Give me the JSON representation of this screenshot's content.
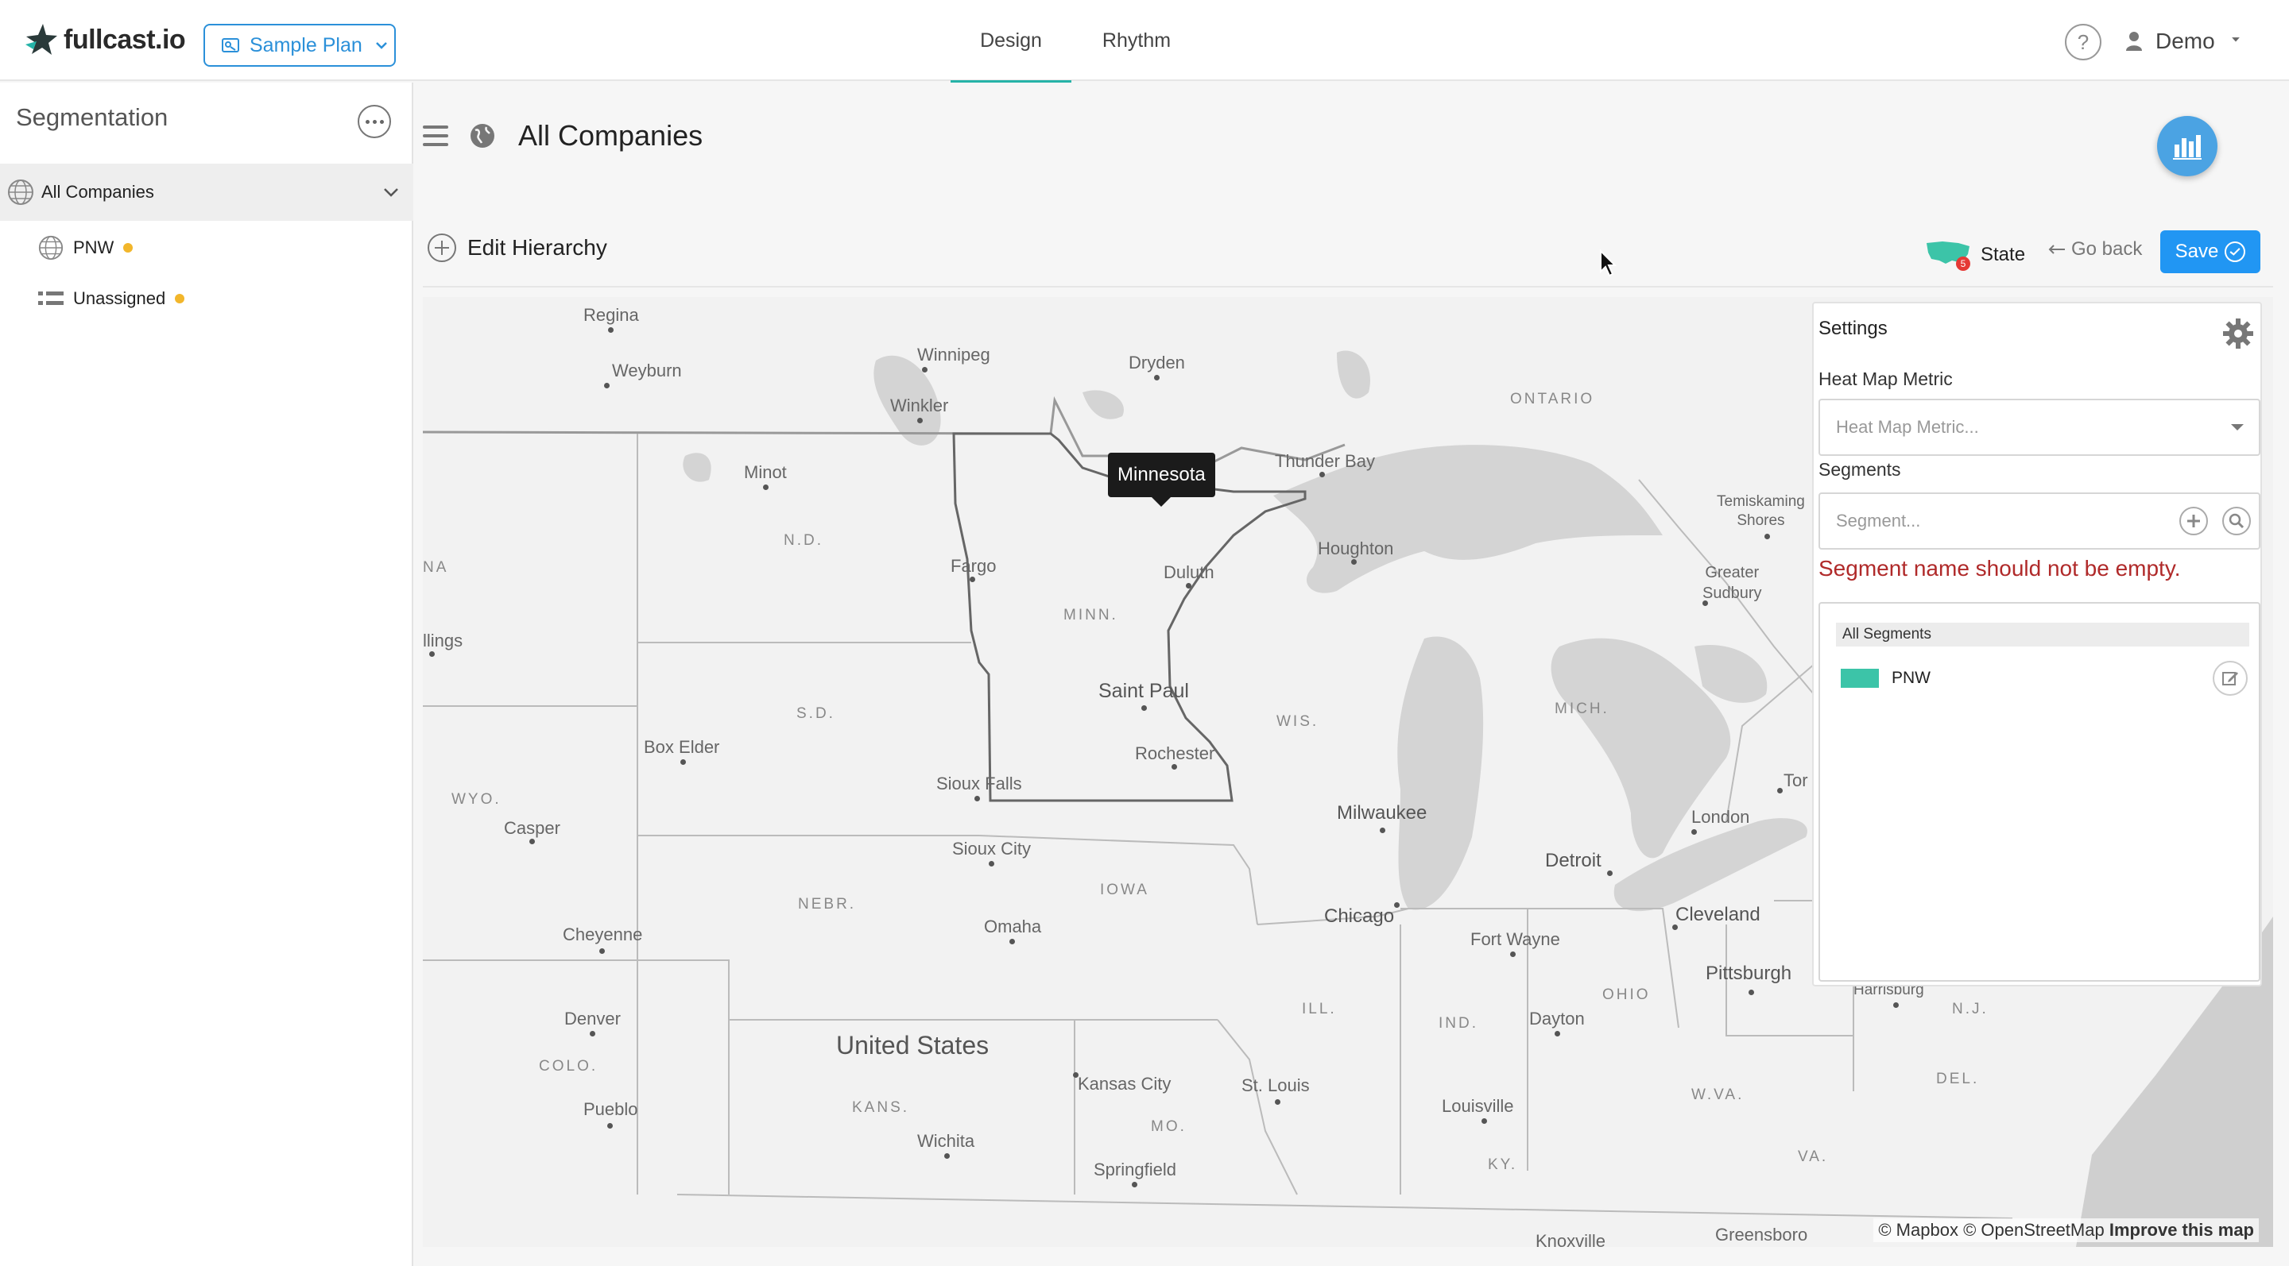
{
  "app": {
    "logo_text": "fullcast.io",
    "plan_button": "Sample Plan",
    "nav_tabs": [
      {
        "label": "Design",
        "active": true
      },
      {
        "label": "Rhythm",
        "active": false
      }
    ],
    "help_label": "?",
    "user_name": "Demo"
  },
  "sidebar": {
    "title": "Segmentation",
    "root_item": "All Companies",
    "children": [
      {
        "label": "PNW",
        "status_color": "#f2b62b"
      },
      {
        "label": "Unassigned",
        "status_color": "#f2b62b"
      }
    ]
  },
  "main": {
    "title": "All Companies",
    "edit_hierarchy": "Edit Hierarchy",
    "state_toggle": "State",
    "state_badge": "5",
    "go_back": "Go back",
    "save": "Save"
  },
  "map": {
    "tooltip": "Minnesota",
    "labels": {
      "regina": "Regina",
      "weyburn": "Weyburn",
      "winnipeg": "Winnipeg",
      "winkler": "Winkler",
      "dryden": "Dryden",
      "ontario": "ONTARIO",
      "thunder_bay": "Thunder Bay",
      "minot": "Minot",
      "nd": "N.D.",
      "fargo": "Fargo",
      "duluth": "Duluth",
      "houghton": "Houghton",
      "minn": "MINN.",
      "temiskaming": "Temiskaming\nShores",
      "greater_sudbury": "Greater\nSudbury",
      "na": "NA",
      "billings": "llings",
      "sd": "S.D.",
      "saint_paul": "Saint Paul",
      "wis": "WIS.",
      "mich": "MICH.",
      "box_elder": "Box Elder",
      "rochester": "Rochester",
      "wyo": "WYO.",
      "casper": "Casper",
      "sioux_falls": "Sioux Falls",
      "milwaukee": "Milwaukee",
      "london": "London",
      "tor": "Tor",
      "sioux_city": "Sioux City",
      "detroit": "Detroit",
      "iowa": "IOWA",
      "nebr": "NEBR.",
      "cleveland": "Cleveland",
      "chicago": "Chicago",
      "omaha": "Omaha",
      "fort_wayne": "Fort Wayne",
      "cheyenne": "Cheyenne",
      "pittsburgh": "Pittsburgh",
      "harrisburg": "Harrisburg",
      "ohio": "OHIO",
      "ill": "ILL.",
      "ind": "IND.",
      "dayton": "Dayton",
      "nj": "N.J.",
      "denver": "Denver",
      "colo": "COLO.",
      "united_states": "United States",
      "kansas_city": "Kansas City",
      "st_louis": "St. Louis",
      "del": "DEL.",
      "wva": "W.VA.",
      "pueblo": "Pueblo",
      "kans": "KANS.",
      "louisville": "Louisville",
      "mo": "MO.",
      "wichita": "Wichita",
      "va": "VA.",
      "ky": "KY.",
      "springfield": "Springfield",
      "knoxville": "Knoxville",
      "greensboro": "Greensboro"
    },
    "attribution": {
      "mapbox": "© Mapbox",
      "osm": "© OpenStreetMap",
      "improve": "Improve this map"
    }
  },
  "settings": {
    "title": "Settings",
    "heatmap_label": "Heat Map Metric",
    "heatmap_placeholder": "Heat Map Metric...",
    "segments_label": "Segments",
    "segment_placeholder": "Segment...",
    "error": "Segment name should not be empty.",
    "list_header": "All Segments",
    "segments": [
      {
        "name": "PNW",
        "color": "#3cc4a8"
      }
    ]
  },
  "colors": {
    "accent": "#2196f3",
    "brand_teal": "#26b3a8",
    "error": "#b02a2a"
  }
}
